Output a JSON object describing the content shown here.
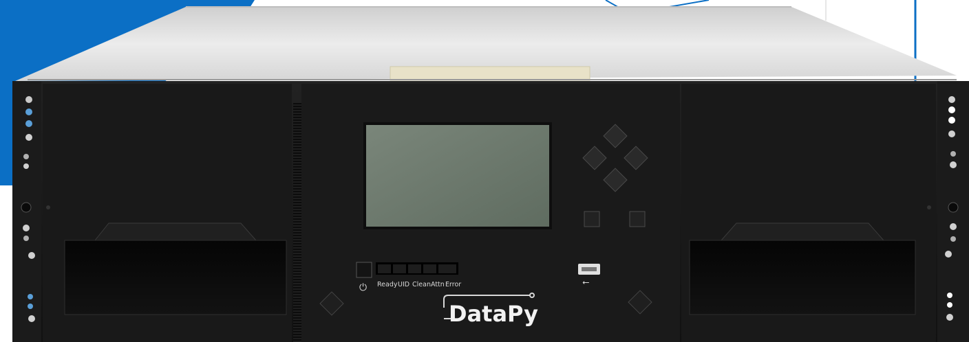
{
  "brand": {
    "name": "DataPy"
  },
  "status_leds": {
    "labels": [
      "Ready",
      "UID",
      "Clean",
      "Attn",
      "Error"
    ],
    "power_symbol": "⏻"
  },
  "usb": {
    "symbol": "⭠"
  },
  "colors": {
    "accent_blue": "#0b6fc5",
    "chassis_black": "#161616",
    "lid_silver": "#e3e3e3",
    "lcd_green": "#6d7a6c",
    "led_blue": "#5a9fd8"
  },
  "icons": [
    "power-icon",
    "usb-icon",
    "nav-up-icon",
    "nav-down-icon",
    "nav-left-icon",
    "nav-right-icon"
  ]
}
